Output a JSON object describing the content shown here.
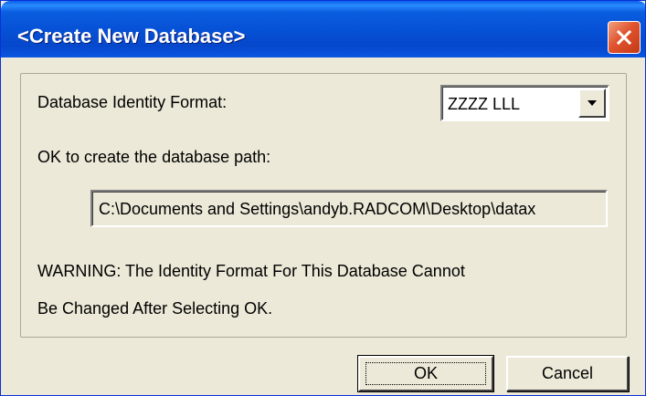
{
  "window": {
    "title": "<Create New Database>"
  },
  "form": {
    "identity_label": "Database Identity Format:",
    "identity_value": "ZZZZ LLL",
    "path_label": "OK to create the database path:",
    "path_value": "C:\\Documents and Settings\\andyb.RADCOM\\Desktop\\datax",
    "warning_line1": "WARNING: The Identity Format For This Database Cannot",
    "warning_line2": "Be Changed After Selecting OK."
  },
  "buttons": {
    "ok_label": "OK",
    "cancel_label": "Cancel"
  },
  "icons": {
    "close": "close-icon",
    "dropdown": "chevron-down-icon"
  },
  "colors": {
    "titlebar": "#0650d4",
    "close_button": "#e0542f",
    "dialog_background": "#ece9d8"
  }
}
